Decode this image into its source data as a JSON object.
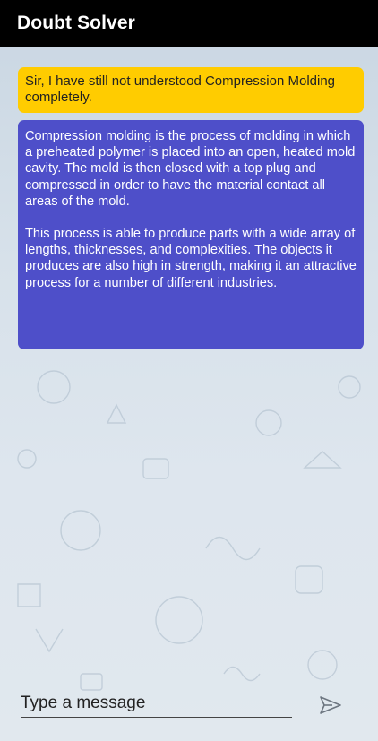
{
  "app_bar": {
    "title": "Doubt Solver"
  },
  "messages": [
    {
      "role": "user",
      "text": "Sir, I have still not understood Compression Molding completely."
    },
    {
      "role": "bot",
      "paragraphs": [
        "Compression molding is the process of molding in which a preheated polymer is placed into an open, heated mold cavity. The mold is then closed with a top plug and compressed in order to have the material contact all areas of the mold.",
        "This process is able to produce parts with a wide array of lengths, thicknesses, and complexities. The objects it produces are also high in strength, making it an attractive process for a number of different industries."
      ]
    }
  ],
  "composer": {
    "placeholder": "Type a message",
    "value": "",
    "send_icon": "send-icon"
  },
  "colors": {
    "app_bar": "#000000",
    "user_bubble": "#ffcc00",
    "bot_bubble": "#4e4fc9",
    "background": "#d9e2ea"
  }
}
